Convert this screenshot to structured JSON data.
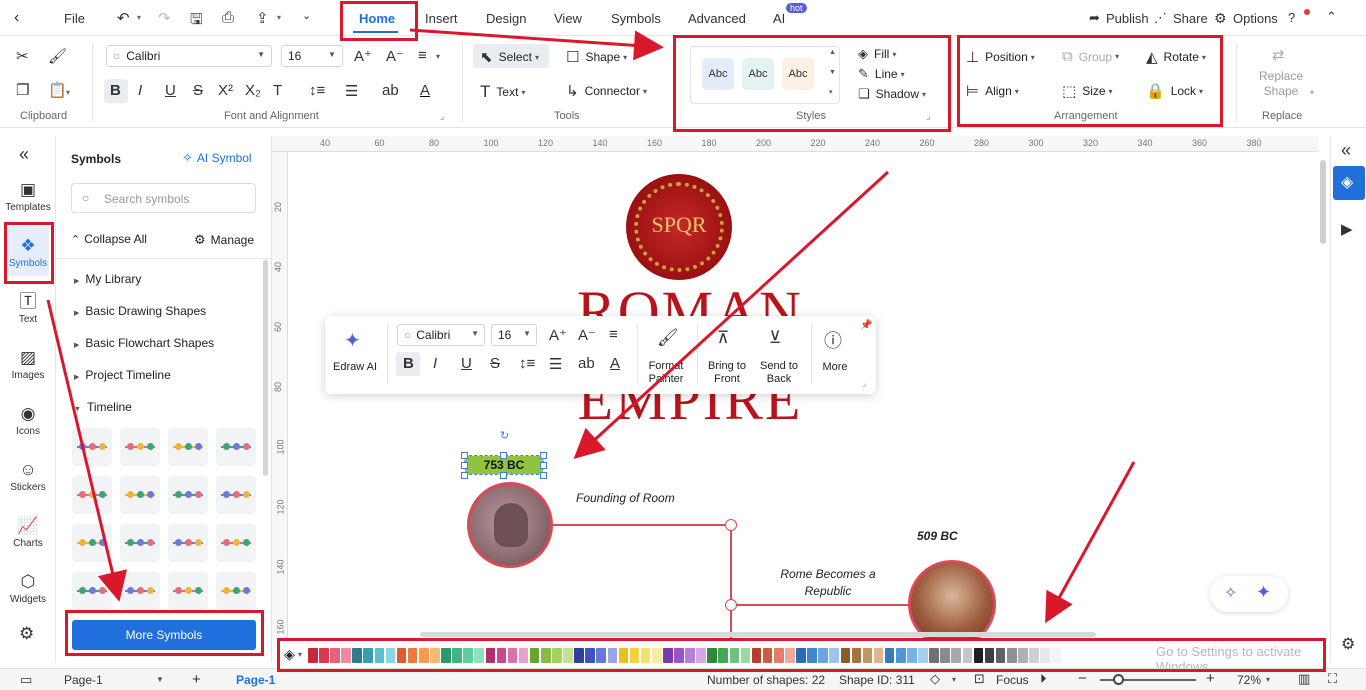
{
  "menu": {
    "file": "File",
    "tabs": [
      "Home",
      "Insert",
      "Design",
      "View",
      "Symbols",
      "Advanced",
      "AI"
    ],
    "ai_badge": "hot",
    "publish": "Publish",
    "share": "Share",
    "options": "Options"
  },
  "ribbon": {
    "font_name": "Calibri",
    "font_size": "16",
    "select": "Select",
    "shape": "Shape",
    "text": "Text",
    "connector": "Connector",
    "style_samples": [
      "Abc",
      "Abc",
      "Abc"
    ],
    "fill": "Fill",
    "line": "Line",
    "shadow": "Shadow",
    "position": "Position",
    "group": "Group",
    "rotate": "Rotate",
    "align": "Align",
    "size": "Size",
    "lock": "Lock",
    "replace_shape_1": "Replace",
    "replace_shape_2": "Shape",
    "groups": {
      "clipboard": "Clipboard",
      "font": "Font and Alignment",
      "tools": "Tools",
      "styles": "Styles",
      "arrangement": "Arrangement",
      "replace": "Replace"
    }
  },
  "rail": [
    "Templates",
    "Symbols",
    "Text",
    "Images",
    "Icons",
    "Stickers",
    "Charts",
    "Widgets"
  ],
  "panel": {
    "title": "Symbols",
    "ai_symbol": "AI Symbol",
    "search_placeholder": "Search symbols",
    "collapse_all": "Collapse All",
    "manage": "Manage",
    "libraries": [
      "My Library",
      "Basic Drawing Shapes",
      "Basic Flowchart Shapes",
      "Project Timeline",
      "Timeline"
    ],
    "more_symbols": "More Symbols"
  },
  "ruler": {
    "top": [
      "40",
      "60",
      "80",
      "100",
      "120",
      "140",
      "160",
      "180",
      "200",
      "220",
      "240",
      "260",
      "280",
      "300",
      "320",
      "340",
      "360",
      "380"
    ],
    "left": [
      "20",
      "40",
      "60",
      "80",
      "100",
      "120",
      "140",
      "160"
    ]
  },
  "canvas": {
    "spqr": "SPQR",
    "title_line1": "ROMAN",
    "title_line2": "EMPIRE",
    "date1": "753 BC",
    "event1": "Founding of Room",
    "date2": "509 BC",
    "event2_line1": "Rome Becomes a",
    "event2_line2": "Republic"
  },
  "floatbar": {
    "edraw_ai": "Edraw AI",
    "font_name": "Calibri",
    "font_size": "16",
    "format_painter_1": "Format",
    "format_painter_2": "Painter",
    "bring_front_1": "Bring to",
    "bring_front_2": "Front",
    "send_back_1": "Send to",
    "send_back_2": "Back",
    "more": "More"
  },
  "watermark": "Go to Settings to activate Windows.",
  "status": {
    "page_select": "Page-1",
    "page_tab": "Page-1",
    "shape_count": "Number of shapes: 22",
    "shape_id": "Shape ID: 311",
    "focus": "Focus",
    "zoom": "72%"
  },
  "colors": {
    "accent": "#1f6fdc",
    "annotation_red": "#d9182c",
    "date_green": "#8fc43f",
    "title_red": "#b8141c"
  }
}
